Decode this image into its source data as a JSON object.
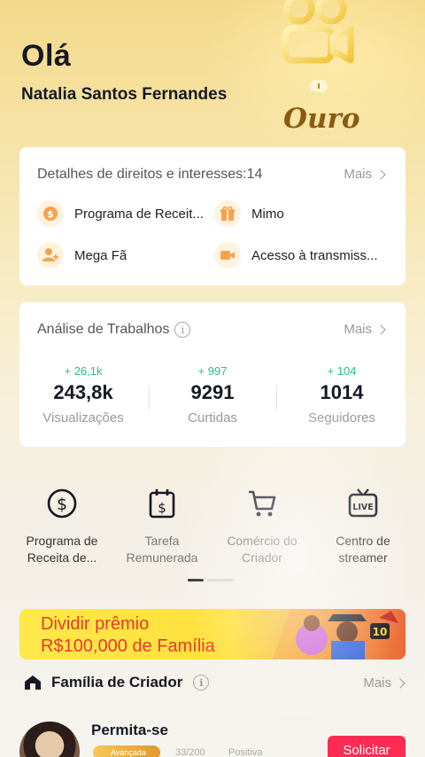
{
  "header": {
    "greeting": "Olá",
    "username": "Natalia Santos Fernandes",
    "tier": "Ouro"
  },
  "rights": {
    "title": "Detalhes de direitos e interesses:14",
    "more": "Mais",
    "items": [
      {
        "label": "Programa de Receit...",
        "icon": "dollar-coin-icon"
      },
      {
        "label": "Mimo",
        "icon": "gift-icon"
      },
      {
        "label": "Mega Fã",
        "icon": "user-plus-icon"
      },
      {
        "label": "Acesso à transmiss...",
        "icon": "video-camera-icon"
      }
    ]
  },
  "analytics": {
    "title": "Análise de Trabalhos",
    "more": "Mais",
    "stats": [
      {
        "delta": "+ 26,1k",
        "value": "243,8k",
        "label": "Visualizações"
      },
      {
        "delta": "+ 997",
        "value": "9291",
        "label": "Curtidas"
      },
      {
        "delta": "+ 104",
        "value": "1014",
        "label": "Seguidores"
      }
    ]
  },
  "tools": [
    {
      "label": "Programa de Receita de...",
      "icon": "dollar-circle-icon"
    },
    {
      "label": "Tarefa Remunerada",
      "icon": "calendar-dollar-icon"
    },
    {
      "label": "Comércio do Criador",
      "icon": "shopping-cart-icon"
    },
    {
      "label": "Centro de streamer",
      "icon": "live-tv-icon"
    }
  ],
  "banner": {
    "line1": "Dividir prêmio",
    "line2": "R$100,000 de Família",
    "badge": "10"
  },
  "family": {
    "title": "Família de Criador",
    "more": "Mais",
    "creator": {
      "name": "Permita-se",
      "level": "Avançada",
      "count": "33/200",
      "status": "Positiva",
      "action": "Solicitar"
    }
  },
  "colors": {
    "accent": "#fe2c55",
    "positive": "#27c17e",
    "gold": "#8b5a12",
    "banner_text": "#e63b2e"
  }
}
